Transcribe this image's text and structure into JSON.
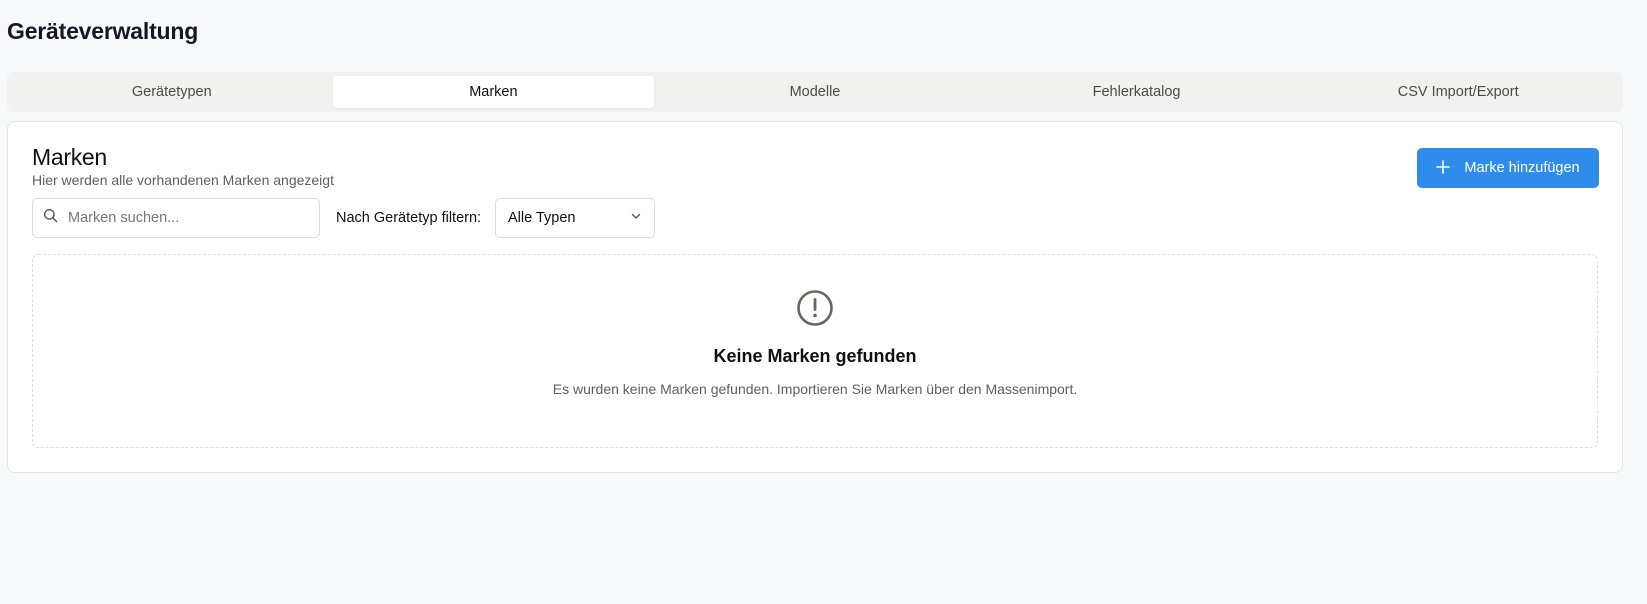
{
  "page": {
    "title": "Geräteverwaltung"
  },
  "tabs": [
    {
      "label": "Gerätetypen",
      "active": false
    },
    {
      "label": "Marken",
      "active": true
    },
    {
      "label": "Modelle",
      "active": false
    },
    {
      "label": "Fehlerkatalog",
      "active": false
    },
    {
      "label": "CSV Import/Export",
      "active": false
    }
  ],
  "card": {
    "title": "Marken",
    "subtitle": "Hier werden alle vorhandenen Marken angezeigt",
    "add_button": {
      "label": "Marke hinzufügen",
      "icon": "plus-icon"
    }
  },
  "search": {
    "placeholder": "Marken suchen...",
    "value": "",
    "icon": "search-icon"
  },
  "filter": {
    "label": "Nach Gerätetyp filtern:",
    "selected": "Alle Typen",
    "icon": "chevron-down-icon"
  },
  "empty_state": {
    "icon": "alert-circle-icon",
    "title": "Keine Marken gefunden",
    "message": "Es wurden keine Marken gefunden. Importieren Sie Marken über den Massenimport."
  },
  "colors": {
    "background": "#f8f9fa",
    "accent": "#2f8ceb",
    "tab_bar": "#f1f1ef",
    "muted_text": "#5f5f5f"
  }
}
